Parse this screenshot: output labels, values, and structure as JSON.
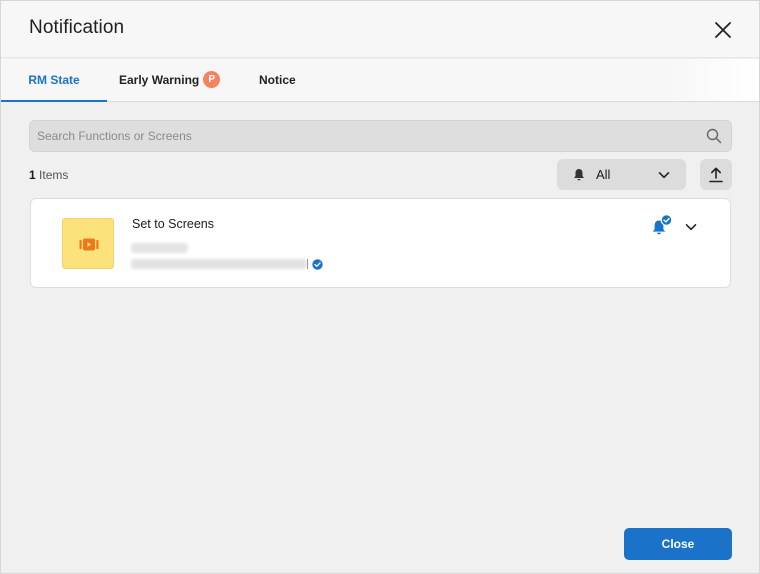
{
  "dialog": {
    "title": "Notification",
    "close_icon": "close-icon"
  },
  "tabs": [
    {
      "label": "RM State",
      "active": true
    },
    {
      "label": "Early Warning",
      "badge": "P",
      "active": false
    },
    {
      "label": "Notice",
      "active": false
    }
  ],
  "search": {
    "placeholder": "Search Functions or Screens",
    "value": "",
    "icon": "search-icon"
  },
  "list": {
    "count": "1",
    "count_suffix": " Items"
  },
  "filter": {
    "selected": "All",
    "icon": "bell-icon"
  },
  "export": {
    "icon": "upload-icon"
  },
  "items": [
    {
      "name": "Set to Screens",
      "thumb_icon": "screen-play-icon",
      "status_icon": "bell-check-icon"
    }
  ],
  "footer": {
    "close_label": "Close"
  },
  "colors": {
    "accent": "#1a73c8",
    "badge": "#f4845f",
    "thumb": "#fbe27a",
    "thumb_icon": "#f0761a"
  }
}
